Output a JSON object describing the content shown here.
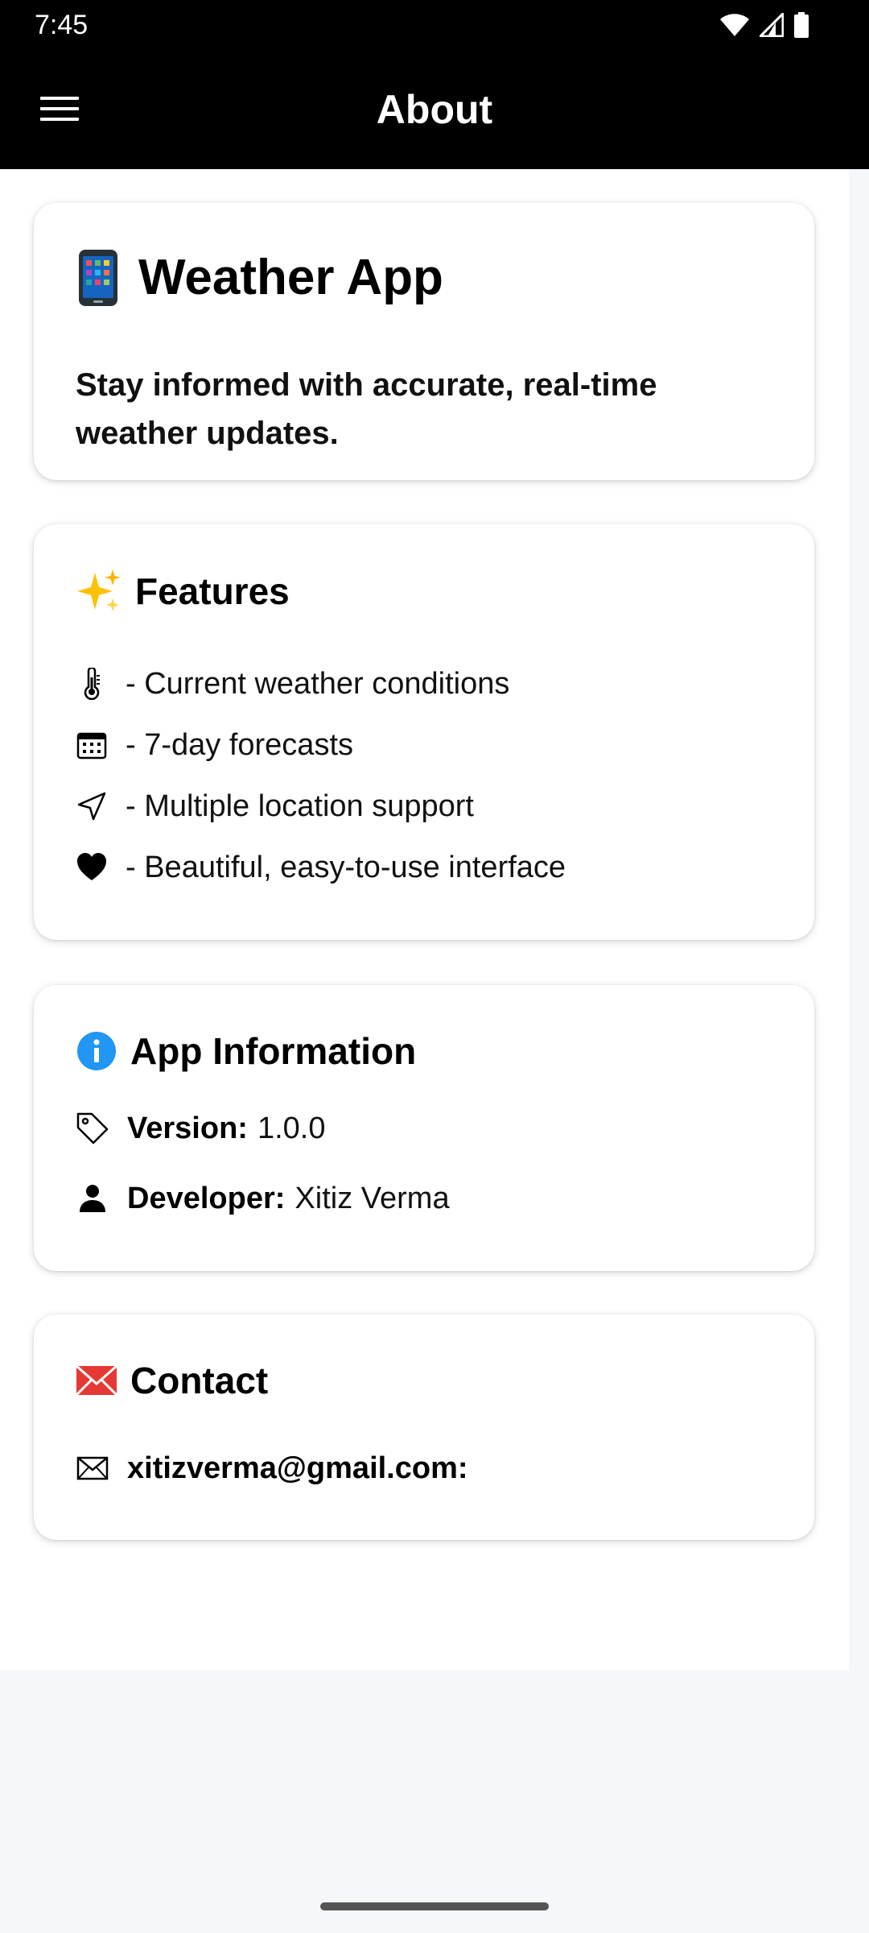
{
  "status_bar": {
    "time": "7:45",
    "icons": [
      "wifi-icon",
      "signal-icon",
      "battery-icon"
    ]
  },
  "app_bar": {
    "title": "About",
    "menu_icon": "hamburger-menu-icon"
  },
  "colors": {
    "app_bar_bg": "#000000",
    "page_bg": "#f4f8f8",
    "card_bg": "#ffffff",
    "info_accent": "#2196f3",
    "contact_accent": "#e53935"
  },
  "app_card": {
    "emoji_icon": "mobile-phone-icon",
    "title": "Weather App",
    "description": "Stay informed with accurate, real-time weather updates."
  },
  "features_card": {
    "emoji_icon": "sparkles-icon",
    "title": "Features",
    "items": [
      {
        "icon": "thermometer-icon",
        "label": "- Current weather conditions"
      },
      {
        "icon": "calendar-icon",
        "label": "- 7-day forecasts"
      },
      {
        "icon": "navigation-icon",
        "label": "- Multiple location support"
      },
      {
        "icon": "heart-icon",
        "label": "- Beautiful, easy-to-use interface"
      }
    ]
  },
  "info_card": {
    "icon": "info-icon",
    "title": "App Information",
    "version_label": "Version:",
    "version_value": "1.0.0",
    "developer_label": "Developer:",
    "developer_value": "Xitiz Verma"
  },
  "contact_card": {
    "icon": "envelope-icon",
    "title": "Contact",
    "email": "xitizverma@gmail.com:"
  }
}
